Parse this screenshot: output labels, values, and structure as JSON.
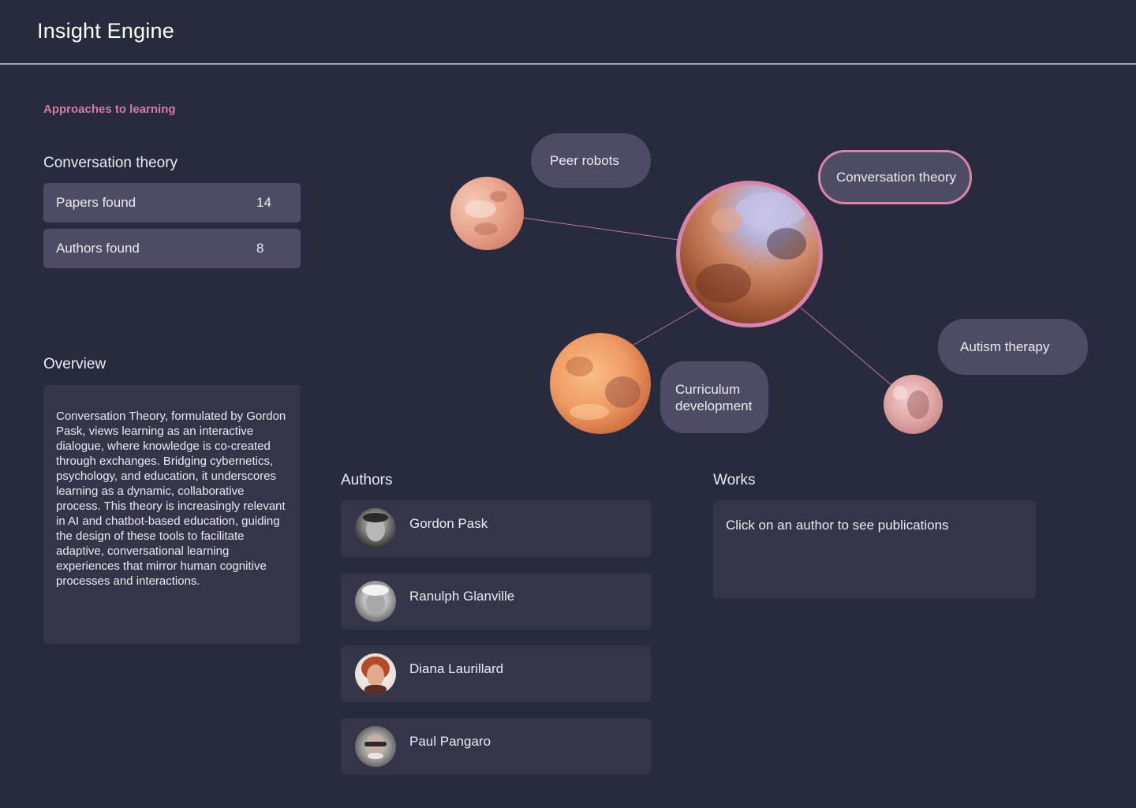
{
  "app": {
    "title": "Insight Engine"
  },
  "sidebar": {
    "section_label": "Approaches to learning",
    "topic_title": "Conversation theory",
    "stats": [
      {
        "label": "Papers found",
        "value": "14"
      },
      {
        "label": "Authors found",
        "value": "8"
      }
    ],
    "overview_title": "Overview",
    "overview_text": "Conversation Theory, formulated by Gordon Pask, views learning as an interactive dialogue, where knowledge is co-created through exchanges. Bridging cybernetics, psychology, and education, it underscores learning as a dynamic, collaborative process. This theory is increasingly relevant in AI and chatbot-based education, guiding the design of these tools to facilitate adaptive, conversational learning experiences that mirror human cognitive processes and interactions."
  },
  "graph": {
    "nodes": [
      {
        "label": "Peer robots"
      },
      {
        "label": "Conversation theory",
        "selected": true
      },
      {
        "label": "Curriculum development"
      },
      {
        "label": "Autism therapy"
      }
    ],
    "accent_color": "#d884ac"
  },
  "authors": {
    "title": "Authors",
    "items": [
      {
        "name": "Gordon Pask"
      },
      {
        "name": "Ranulph Glanville"
      },
      {
        "name": "Diana Laurillard"
      },
      {
        "name": "Paul Pangaro"
      }
    ]
  },
  "works": {
    "title": "Works",
    "placeholder": "Click on an author to see publications"
  }
}
